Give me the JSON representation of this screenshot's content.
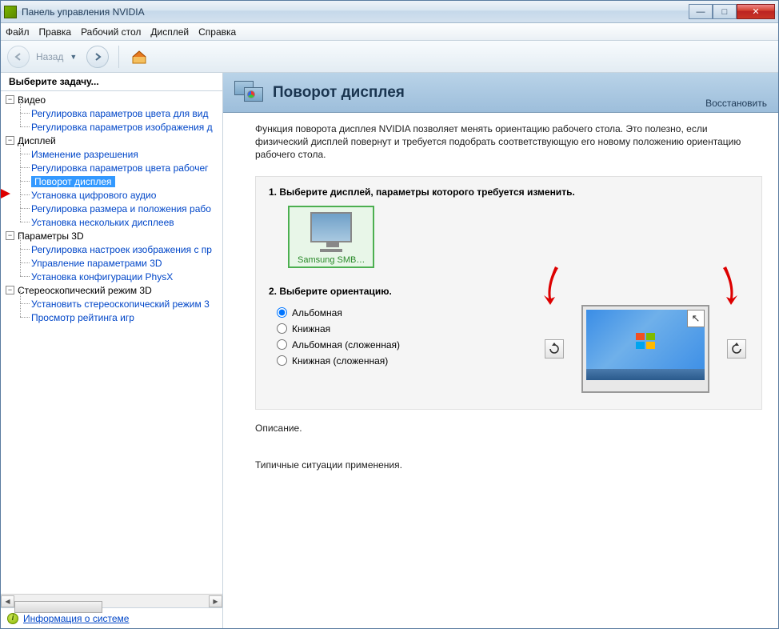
{
  "window": {
    "title": "Панель управления NVIDIA"
  },
  "menu": {
    "file": "Файл",
    "edit": "Правка",
    "desktop": "Рабочий стол",
    "display": "Дисплей",
    "help": "Справка"
  },
  "toolbar": {
    "back": "Назад"
  },
  "sidebar": {
    "header": "Выберите задачу...",
    "groups": [
      {
        "label": "Видео",
        "items": [
          "Регулировка параметров цвета для вид",
          "Регулировка параметров изображения д"
        ]
      },
      {
        "label": "Дисплей",
        "items": [
          "Изменение разрешения",
          "Регулировка параметров цвета рабочег",
          "Поворот дисплея",
          "Установка цифрового аудио",
          "Регулировка размера и положения рабо",
          "Установка нескольких дисплеев"
        ]
      },
      {
        "label": "Параметры 3D",
        "items": [
          "Регулировка настроек изображения с пр",
          "Управление параметрами 3D",
          "Установка конфигурации PhysX"
        ]
      },
      {
        "label": "Стереоскопический режим 3D",
        "items": [
          "Установить стереоскопический режим 3",
          "Просмотр рейтинга игр"
        ]
      }
    ],
    "selected": "Поворот дисплея",
    "sysinfo": "Информация о системе"
  },
  "main": {
    "title": "Поворот дисплея",
    "restore": "Восстановить",
    "description": "Функция поворота дисплея NVIDIA позволяет менять ориентацию рабочего стола. Это полезно, если физический дисплей повернут и требуется подобрать соответствующую его новому положению ориентацию рабочего стола.",
    "step1": "1. Выберите дисплей, параметры которого требуется изменить.",
    "display_name": "Samsung SMB…",
    "step2": "2. Выберите ориентацию.",
    "orientations": [
      "Альбомная",
      "Книжная",
      "Альбомная (сложенная)",
      "Книжная (сложенная)"
    ],
    "selected_orientation": 0,
    "desc_label": "Описание.",
    "usage_label": "Типичные ситуации применения."
  }
}
